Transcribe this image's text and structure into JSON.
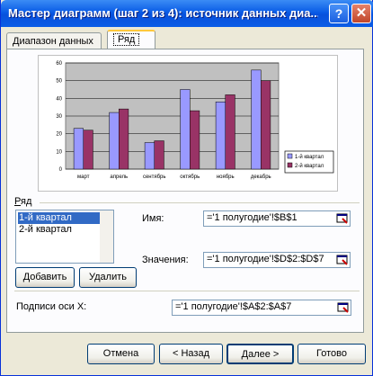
{
  "window": {
    "title": "Мастер диаграмм (шаг 2 из 4): источник данных диа..."
  },
  "title_buttons": {
    "help": "?",
    "close": "✕"
  },
  "tabs": [
    {
      "label": "Диапазон данных"
    },
    {
      "label": "Ряд"
    }
  ],
  "chart_data": {
    "type": "bar",
    "categories": [
      "март",
      "апрель",
      "сентябрь",
      "октябрь",
      "ноябрь",
      "декабрь"
    ],
    "series": [
      {
        "name": "1-й квартал",
        "values": [
          23,
          32,
          15,
          45,
          38,
          56
        ],
        "color": "#9999ff"
      },
      {
        "name": "2-й квартал",
        "values": [
          22,
          34,
          16,
          33,
          42,
          50
        ],
        "color": "#993366"
      }
    ],
    "ylim": [
      0,
      60
    ],
    "yticks": [
      "0",
      "10",
      "20",
      "30",
      "40",
      "50",
      "60"
    ],
    "plot_background": "#c0c0c0",
    "grid": true,
    "legend": "right"
  },
  "series_section": {
    "label": "Ряд",
    "items": [
      "1-й квартал",
      "2-й квартал"
    ],
    "selected": 0,
    "add_label": "Добавить",
    "delete_label": "Удалить"
  },
  "fields": {
    "name_label": "Имя:",
    "name_value": "='1 полугодие'!$B$1",
    "values_label": "Значения:",
    "values_value": "='1 полугодие'!$D$2:$D$7",
    "xlabels_label": "Подписи оси X:",
    "xlabels_value": "='1 полугодие'!$A$2:$A$7"
  },
  "footer": {
    "cancel": "Отмена",
    "back": "< Назад",
    "next": "Далее >",
    "finish": "Готово"
  }
}
